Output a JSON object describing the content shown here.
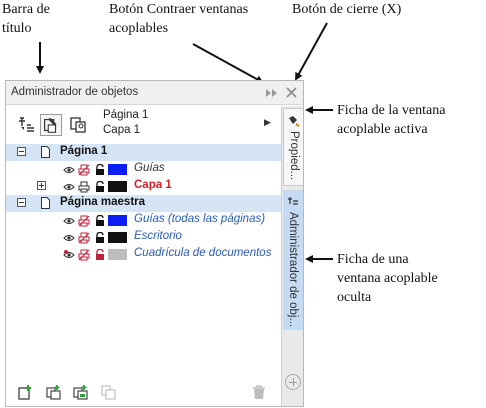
{
  "annotations": {
    "title_bar": "Barra de\ntítulo",
    "collapse_button": "Botón Contraer ventanas\nacoplables",
    "close_button": "Botón de cierre (X)",
    "active_tab": "Ficha de la ventana\nacoplable activa",
    "hidden_tab": "Ficha de una\nventana acoplable\noculta"
  },
  "docker": {
    "title": "Administrador de objetos",
    "page_info": {
      "page": "Página 1",
      "layer": "Capa 1"
    },
    "tree": [
      {
        "label": "Página 1",
        "type": "page-header",
        "expander": "minus"
      },
      {
        "label": "Guías",
        "type": "layer",
        "color": "#0a1ef5",
        "style": "italic-dark"
      },
      {
        "label": "Capa 1",
        "type": "layer",
        "color": "#111111",
        "style": "red-bold",
        "expander": "plus"
      },
      {
        "label": "Página maestra",
        "type": "page-header",
        "expander": "minus"
      },
      {
        "label": "Guías (todas las páginas)",
        "type": "layer",
        "color": "#0a1ef5",
        "style": "italic-blue"
      },
      {
        "label": "Escritorio",
        "type": "layer",
        "color": "#111111",
        "style": "italic-blue"
      },
      {
        "label": "Cuadrícula de documentos",
        "type": "layer",
        "color": "#bdbdbd",
        "style": "italic-blue"
      }
    ],
    "tabs": [
      {
        "label": "Propied...",
        "state": "active"
      },
      {
        "label": "Administrador de obj...",
        "state": "hidden"
      }
    ]
  },
  "colors": {
    "highlight": "#d6e5f6",
    "tab_blue": "#c5dbf3",
    "lock_red": "#c0203a"
  }
}
